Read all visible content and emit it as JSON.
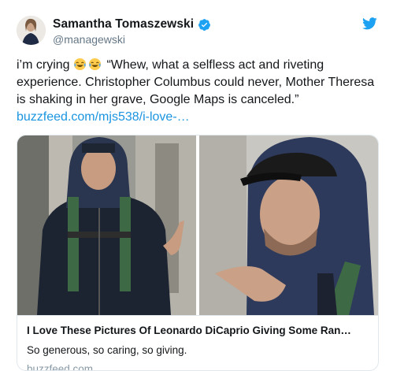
{
  "author": {
    "display_name": "Samantha Tomaszewski",
    "handle": "@managewski",
    "verified": true,
    "avatar_icon": "profile-photo"
  },
  "brand": {
    "icon": "twitter-bird-icon",
    "color": "#1da1f2"
  },
  "tweet": {
    "text_prefix": "i’m crying",
    "emojis": [
      "face-with-tears-of-joy",
      "face-with-tears-of-joy"
    ],
    "text_body": " “Whew, what a selfless act and riveting experience. Christopher Columbus could never, Mother Theresa is shaking in her grave, Google Maps is canceled.”",
    "link_text": "buzzfeed.com/mjs538/i-love-…"
  },
  "card": {
    "title": "I Love These Pictures Of Leonardo DiCaprio Giving Some Ran…",
    "description": "So generous, so caring, so giving.",
    "domain": "buzzfeed.com"
  },
  "colors": {
    "link": "#1b95e0",
    "verified": "#1da1f2",
    "handle": "#657786",
    "border": "#e1e8ed"
  }
}
